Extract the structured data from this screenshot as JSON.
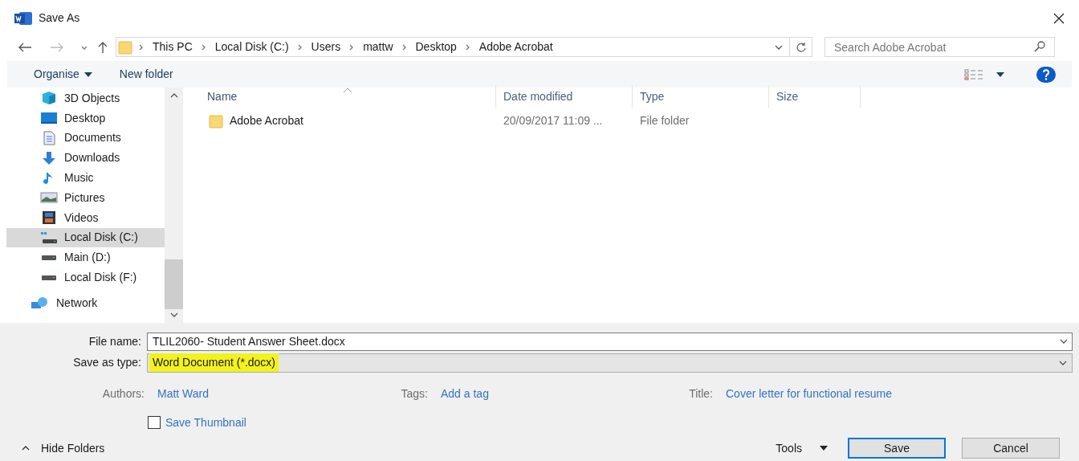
{
  "window": {
    "title": "Save As"
  },
  "address": {
    "crumbs": [
      "This PC",
      "Local Disk (C:)",
      "Users",
      "mattw",
      "Desktop",
      "Adobe Acrobat"
    ]
  },
  "search": {
    "placeholder": "Search Adobe Acrobat"
  },
  "toolbar": {
    "organise": "Organise",
    "new_folder": "New folder"
  },
  "sidebar": {
    "items": [
      {
        "label": "3D Objects",
        "kind": "cube",
        "selected": false
      },
      {
        "label": "Desktop",
        "kind": "desktop",
        "selected": false
      },
      {
        "label": "Documents",
        "kind": "document",
        "selected": false
      },
      {
        "label": "Downloads",
        "kind": "download",
        "selected": false
      },
      {
        "label": "Music",
        "kind": "music",
        "selected": false
      },
      {
        "label": "Pictures",
        "kind": "pictures",
        "selected": false
      },
      {
        "label": "Videos",
        "kind": "video",
        "selected": false
      },
      {
        "label": "Local Disk (C:)",
        "kind": "system-drive",
        "selected": true
      },
      {
        "label": "Main (D:)",
        "kind": "drive",
        "selected": false
      },
      {
        "label": "Local Disk (F:)",
        "kind": "drive",
        "selected": false
      }
    ],
    "network": {
      "label": "Network",
      "selected": false
    }
  },
  "table": {
    "columns": [
      {
        "label": "Name",
        "sorted": true
      },
      {
        "label": "Date modified",
        "sorted": false
      },
      {
        "label": "Type",
        "sorted": false
      },
      {
        "label": "Size",
        "sorted": false
      }
    ],
    "rows": [
      {
        "name": "Adobe Acrobat",
        "date": "20/09/2017 11:09 ...",
        "type": "File folder"
      }
    ]
  },
  "form": {
    "file_name_label": "File name:",
    "file_name": "TLIL2060- Student Answer Sheet.docx",
    "type_label": "Save as type:",
    "type": "Word Document (*.docx)",
    "type_highlighted": true
  },
  "meta": [
    {
      "label": "Authors:",
      "value": "Matt Ward"
    },
    {
      "label": "Tags:",
      "value": "Add a tag"
    },
    {
      "label": "Title:",
      "value": "Cover letter for functional resume"
    }
  ],
  "thumbnail": {
    "label": "Save Thumbnail",
    "checked": false
  },
  "footer": {
    "hide_folders": "Hide Folders",
    "tools": "Tools",
    "save": "Save",
    "cancel": "Cancel"
  }
}
